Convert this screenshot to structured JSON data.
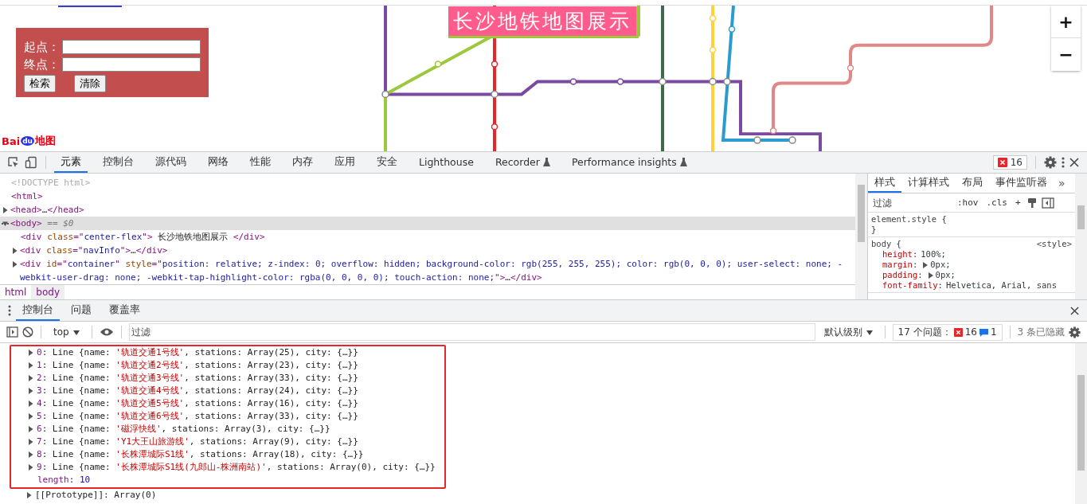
{
  "page": {
    "title": "长沙地铁地图展示",
    "route_form": {
      "fields": [
        {
          "label": "起点："
        },
        {
          "label": "终点："
        }
      ],
      "buttons": [
        "检索",
        "清除"
      ]
    },
    "zoom_buttons": [
      "+",
      "−"
    ],
    "logo": [
      "Bai",
      "du",
      "地图"
    ],
    "map": {
      "kind": "picture"
    }
  },
  "devtools": {
    "tabs": [
      {
        "label": "元素",
        "selected": true,
        "experimental": false
      },
      {
        "label": "控制台",
        "selected": false,
        "experimental": false
      },
      {
        "label": "源代码",
        "selected": false,
        "experimental": false
      },
      {
        "label": "网络",
        "selected": false,
        "experimental": false
      },
      {
        "label": "性能",
        "selected": false,
        "experimental": false
      },
      {
        "label": "内存",
        "selected": false,
        "experimental": false
      },
      {
        "label": "应用",
        "selected": false,
        "experimental": false
      },
      {
        "label": "安全",
        "selected": false,
        "experimental": false
      },
      {
        "label": "Lighthouse",
        "selected": false,
        "experimental": false
      },
      {
        "label": "Recorder",
        "selected": false,
        "experimental": true
      },
      {
        "label": "Performance insights",
        "selected": false,
        "experimental": true
      }
    ],
    "error_count": "16",
    "elements": [
      {
        "selected": false,
        "segments": [
          {
            "kind": "comment",
            "text": "<!DOCTYPE html>"
          }
        ]
      },
      {
        "selected": false,
        "segments": [
          {
            "kind": "tag",
            "text": "<html>"
          }
        ],
        "children": [
          {
            "expanded": false,
            "selected": false,
            "segments": [
              {
                "kind": "tag",
                "text": "<head>"
              },
              {
                "kind": "plain",
                "text": "…"
              },
              {
                "kind": "tag",
                "text": "</head>"
              }
            ]
          },
          {
            "expanded": true,
            "selected": true,
            "segments": [
              {
                "kind": "tag",
                "text": "<body>"
              },
              {
                "kind": "marker",
                "text": " == $0"
              }
            ],
            "children": [
              {
                "selected": false,
                "segments": [
                  {
                    "kind": "tag",
                    "text": "<div "
                  },
                  {
                    "kind": "attr",
                    "text": "class"
                  },
                  {
                    "kind": "tag",
                    "text": "=\""
                  },
                  {
                    "kind": "value",
                    "text": "center-flex"
                  },
                  {
                    "kind": "tag",
                    "text": "\">"
                  },
                  {
                    "kind": "plain",
                    "text": " 长沙地铁地图展示 "
                  },
                  {
                    "kind": "tag",
                    "text": "</div>"
                  }
                ]
              },
              {
                "expanded": false,
                "selected": false,
                "segments": [
                  {
                    "kind": "tag",
                    "text": "<div "
                  },
                  {
                    "kind": "attr",
                    "text": "class"
                  },
                  {
                    "kind": "tag",
                    "text": "=\""
                  },
                  {
                    "kind": "value",
                    "text": "navInfo"
                  },
                  {
                    "kind": "tag",
                    "text": "\">"
                  },
                  {
                    "kind": "plain",
                    "text": "…"
                  },
                  {
                    "kind": "tag",
                    "text": "</div>"
                  }
                ]
              },
              {
                "expanded": false,
                "selected": false,
                "segments": [
                  {
                    "kind": "tag",
                    "text": "<div "
                  },
                  {
                    "kind": "attr",
                    "text": "id"
                  },
                  {
                    "kind": "tag",
                    "text": "=\""
                  },
                  {
                    "kind": "value",
                    "text": "container"
                  },
                  {
                    "kind": "tag",
                    "text": "\" "
                  },
                  {
                    "kind": "attr",
                    "text": "style"
                  },
                  {
                    "kind": "tag",
                    "text": "=\""
                  },
                  {
                    "kind": "value",
                    "text": "position: relative; z-index: 0; overflow: hidden; background-color: rgb(255, 255, 255); color: rgb(0, 0, 0); user-select: none; -webkit-user-drag: none; -webkit-tap-highlight-color: rgba(0, 0, 0, 0); touch-action: none;"
                  },
                  {
                    "kind": "tag",
                    "text": "\">"
                  },
                  {
                    "kind": "plain",
                    "text": "…"
                  },
                  {
                    "kind": "tag",
                    "text": "</div>"
                  }
                ]
              }
            ]
          }
        ]
      }
    ],
    "breadcrumbs": [
      {
        "label": "html",
        "selected": false
      },
      {
        "label": "body",
        "selected": true
      }
    ],
    "styles": {
      "tabs": [
        {
          "label": "样式",
          "selected": true
        },
        {
          "label": "计算样式",
          "selected": false
        },
        {
          "label": "布局",
          "selected": false
        },
        {
          "label": "事件监听器",
          "selected": false
        }
      ],
      "more": "»",
      "filter_placeholder": "过滤",
      "tools": [
        ":hov",
        ".cls",
        "+"
      ],
      "rules": [
        {
          "selector": "element.style",
          "open": "{",
          "close": "}"
        },
        {
          "selector": "body",
          "source": "<style>",
          "open": "{",
          "declarations": [
            {
              "property": "height",
              "separator": ":",
              "value": "100%;",
              "expandable": false
            },
            {
              "property": "margin",
              "separator": ":",
              "value": "0px;",
              "expandable": true
            },
            {
              "property": "padding",
              "separator": ":",
              "value": "0px;",
              "expandable": true
            },
            {
              "property": "font-family",
              "separator": ":",
              "value": "Helvetica, Arial, sans",
              "expandable": false
            }
          ]
        }
      ]
    }
  },
  "console": {
    "tabs": [
      {
        "label": "控制台",
        "selected": true
      },
      {
        "label": "问题",
        "selected": false
      },
      {
        "label": "覆盖率",
        "selected": false
      }
    ],
    "context": "top",
    "filter_placeholder": "过滤",
    "level": "默认级别",
    "issues_label": "17 个问题：",
    "issue_errors": "16",
    "issue_infos": "1",
    "hidden": "3 条已隐藏",
    "output": [
      {
        "highlighted": true,
        "lines": [
          {
            "expandable": true,
            "segments": [
              {
                "kind": "key",
                "text": "0"
              },
              {
                "kind": "plain",
                "text": ": Line {name: "
              },
              {
                "kind": "string",
                "text": "'轨道交通1号线'"
              },
              {
                "kind": "plain",
                "text": ", stations: Array(25), city: {…}}"
              }
            ]
          },
          {
            "expandable": true,
            "segments": [
              {
                "kind": "key",
                "text": "1"
              },
              {
                "kind": "plain",
                "text": ": Line {name: "
              },
              {
                "kind": "string",
                "text": "'轨道交通2号线'"
              },
              {
                "kind": "plain",
                "text": ", stations: Array(23), city: {…}}"
              }
            ]
          },
          {
            "expandable": true,
            "segments": [
              {
                "kind": "key",
                "text": "2"
              },
              {
                "kind": "plain",
                "text": ": Line {name: "
              },
              {
                "kind": "string",
                "text": "'轨道交通3号线'"
              },
              {
                "kind": "plain",
                "text": ", stations: Array(33), city: {…}}"
              }
            ]
          },
          {
            "expandable": true,
            "segments": [
              {
                "kind": "key",
                "text": "3"
              },
              {
                "kind": "plain",
                "text": ": Line {name: "
              },
              {
                "kind": "string",
                "text": "'轨道交通4号线'"
              },
              {
                "kind": "plain",
                "text": ", stations: Array(24), city: {…}}"
              }
            ]
          },
          {
            "expandable": true,
            "segments": [
              {
                "kind": "key",
                "text": "4"
              },
              {
                "kind": "plain",
                "text": ": Line {name: "
              },
              {
                "kind": "string",
                "text": "'轨道交通5号线'"
              },
              {
                "kind": "plain",
                "text": ", stations: Array(16), city: {…}}"
              }
            ]
          },
          {
            "expandable": true,
            "segments": [
              {
                "kind": "key",
                "text": "5"
              },
              {
                "kind": "plain",
                "text": ": Line {name: "
              },
              {
                "kind": "string",
                "text": "'轨道交通6号线'"
              },
              {
                "kind": "plain",
                "text": ", stations: Array(33), city: {…}}"
              }
            ]
          },
          {
            "expandable": true,
            "segments": [
              {
                "kind": "key",
                "text": "6"
              },
              {
                "kind": "plain",
                "text": ": Line {name: "
              },
              {
                "kind": "string",
                "text": "'磁浮快线'"
              },
              {
                "kind": "plain",
                "text": ", stations: Array(3), city: {…}}"
              }
            ]
          },
          {
            "expandable": true,
            "segments": [
              {
                "kind": "key",
                "text": "7"
              },
              {
                "kind": "plain",
                "text": ": Line {name: "
              },
              {
                "kind": "string",
                "text": "'Y1大王山旅游线'"
              },
              {
                "kind": "plain",
                "text": ", stations: Array(9), city: {…}}"
              }
            ]
          },
          {
            "expandable": true,
            "segments": [
              {
                "kind": "key",
                "text": "8"
              },
              {
                "kind": "plain",
                "text": ": Line {name: "
              },
              {
                "kind": "string",
                "text": "'长株潭城际S1线'"
              },
              {
                "kind": "plain",
                "text": ", stations: Array(18), city: {…}}"
              }
            ]
          },
          {
            "expandable": true,
            "segments": [
              {
                "kind": "key",
                "text": "9"
              },
              {
                "kind": "plain",
                "text": ": Line {name: "
              },
              {
                "kind": "string",
                "text": "'长株潭城际S1线(九郎山-株洲南站)'"
              },
              {
                "kind": "plain",
                "text": ", stations: Array(0), city: {…}}"
              }
            ]
          },
          {
            "expandable": false,
            "segments": [
              {
                "kind": "key",
                "text": "length"
              },
              {
                "kind": "plain",
                "text": ": "
              },
              {
                "kind": "number",
                "text": "10"
              }
            ]
          }
        ]
      },
      {
        "highlighted": false,
        "lines": [
          {
            "expandable": true,
            "segments": [
              {
                "kind": "plain",
                "text": "[[Prototype]]: Array(0)"
              }
            ]
          }
        ]
      }
    ]
  }
}
